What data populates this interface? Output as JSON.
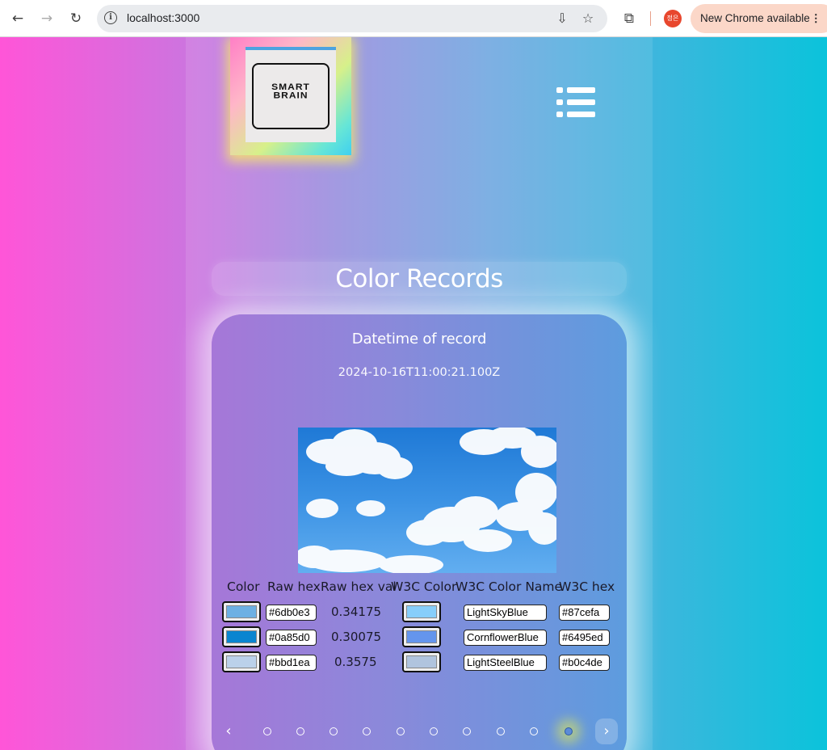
{
  "browser": {
    "url": "localhost:3000",
    "update_label": "New Chrome available",
    "profile_initials": "정은"
  },
  "logo": {
    "line1": "SMART",
    "line2": "BRAIN"
  },
  "page_title": "Color Records",
  "record": {
    "label": "Datetime of record",
    "datetime": "2024-10-16T11:00:21.100Z"
  },
  "table": {
    "headers": [
      "Color",
      "Raw hex",
      "Raw hex val",
      "W3C Color",
      "W3C Color Name",
      "W3C hex"
    ],
    "rows": [
      {
        "color": "#6db0e3",
        "raw_hex": "#6db0e3",
        "raw_hex_val": "0.34175",
        "w3c_color": "#87cefa",
        "w3c_name": "LightSkyBlue",
        "w3c_hex": "#87cefa"
      },
      {
        "color": "#0a85d0",
        "raw_hex": "#0a85d0",
        "raw_hex_val": "0.30075",
        "w3c_color": "#6495ed",
        "w3c_name": "CornflowerBlue",
        "w3c_hex": "#6495ed"
      },
      {
        "color": "#bbd1ea",
        "raw_hex": "#bbd1ea",
        "raw_hex_val": "0.3575",
        "w3c_color": "#b0c4de",
        "w3c_name": "LightSteelBlue",
        "w3c_hex": "#b0c4de"
      }
    ]
  },
  "carousel": {
    "slide_count": 10,
    "active_index": 9
  },
  "icons": [
    "back-icon",
    "forward-icon",
    "reload-icon",
    "info-icon",
    "install-icon",
    "star-icon",
    "extensions-icon",
    "menu-list-icon",
    "chevron-left-icon",
    "chevron-right-icon",
    "more-icon"
  ]
}
